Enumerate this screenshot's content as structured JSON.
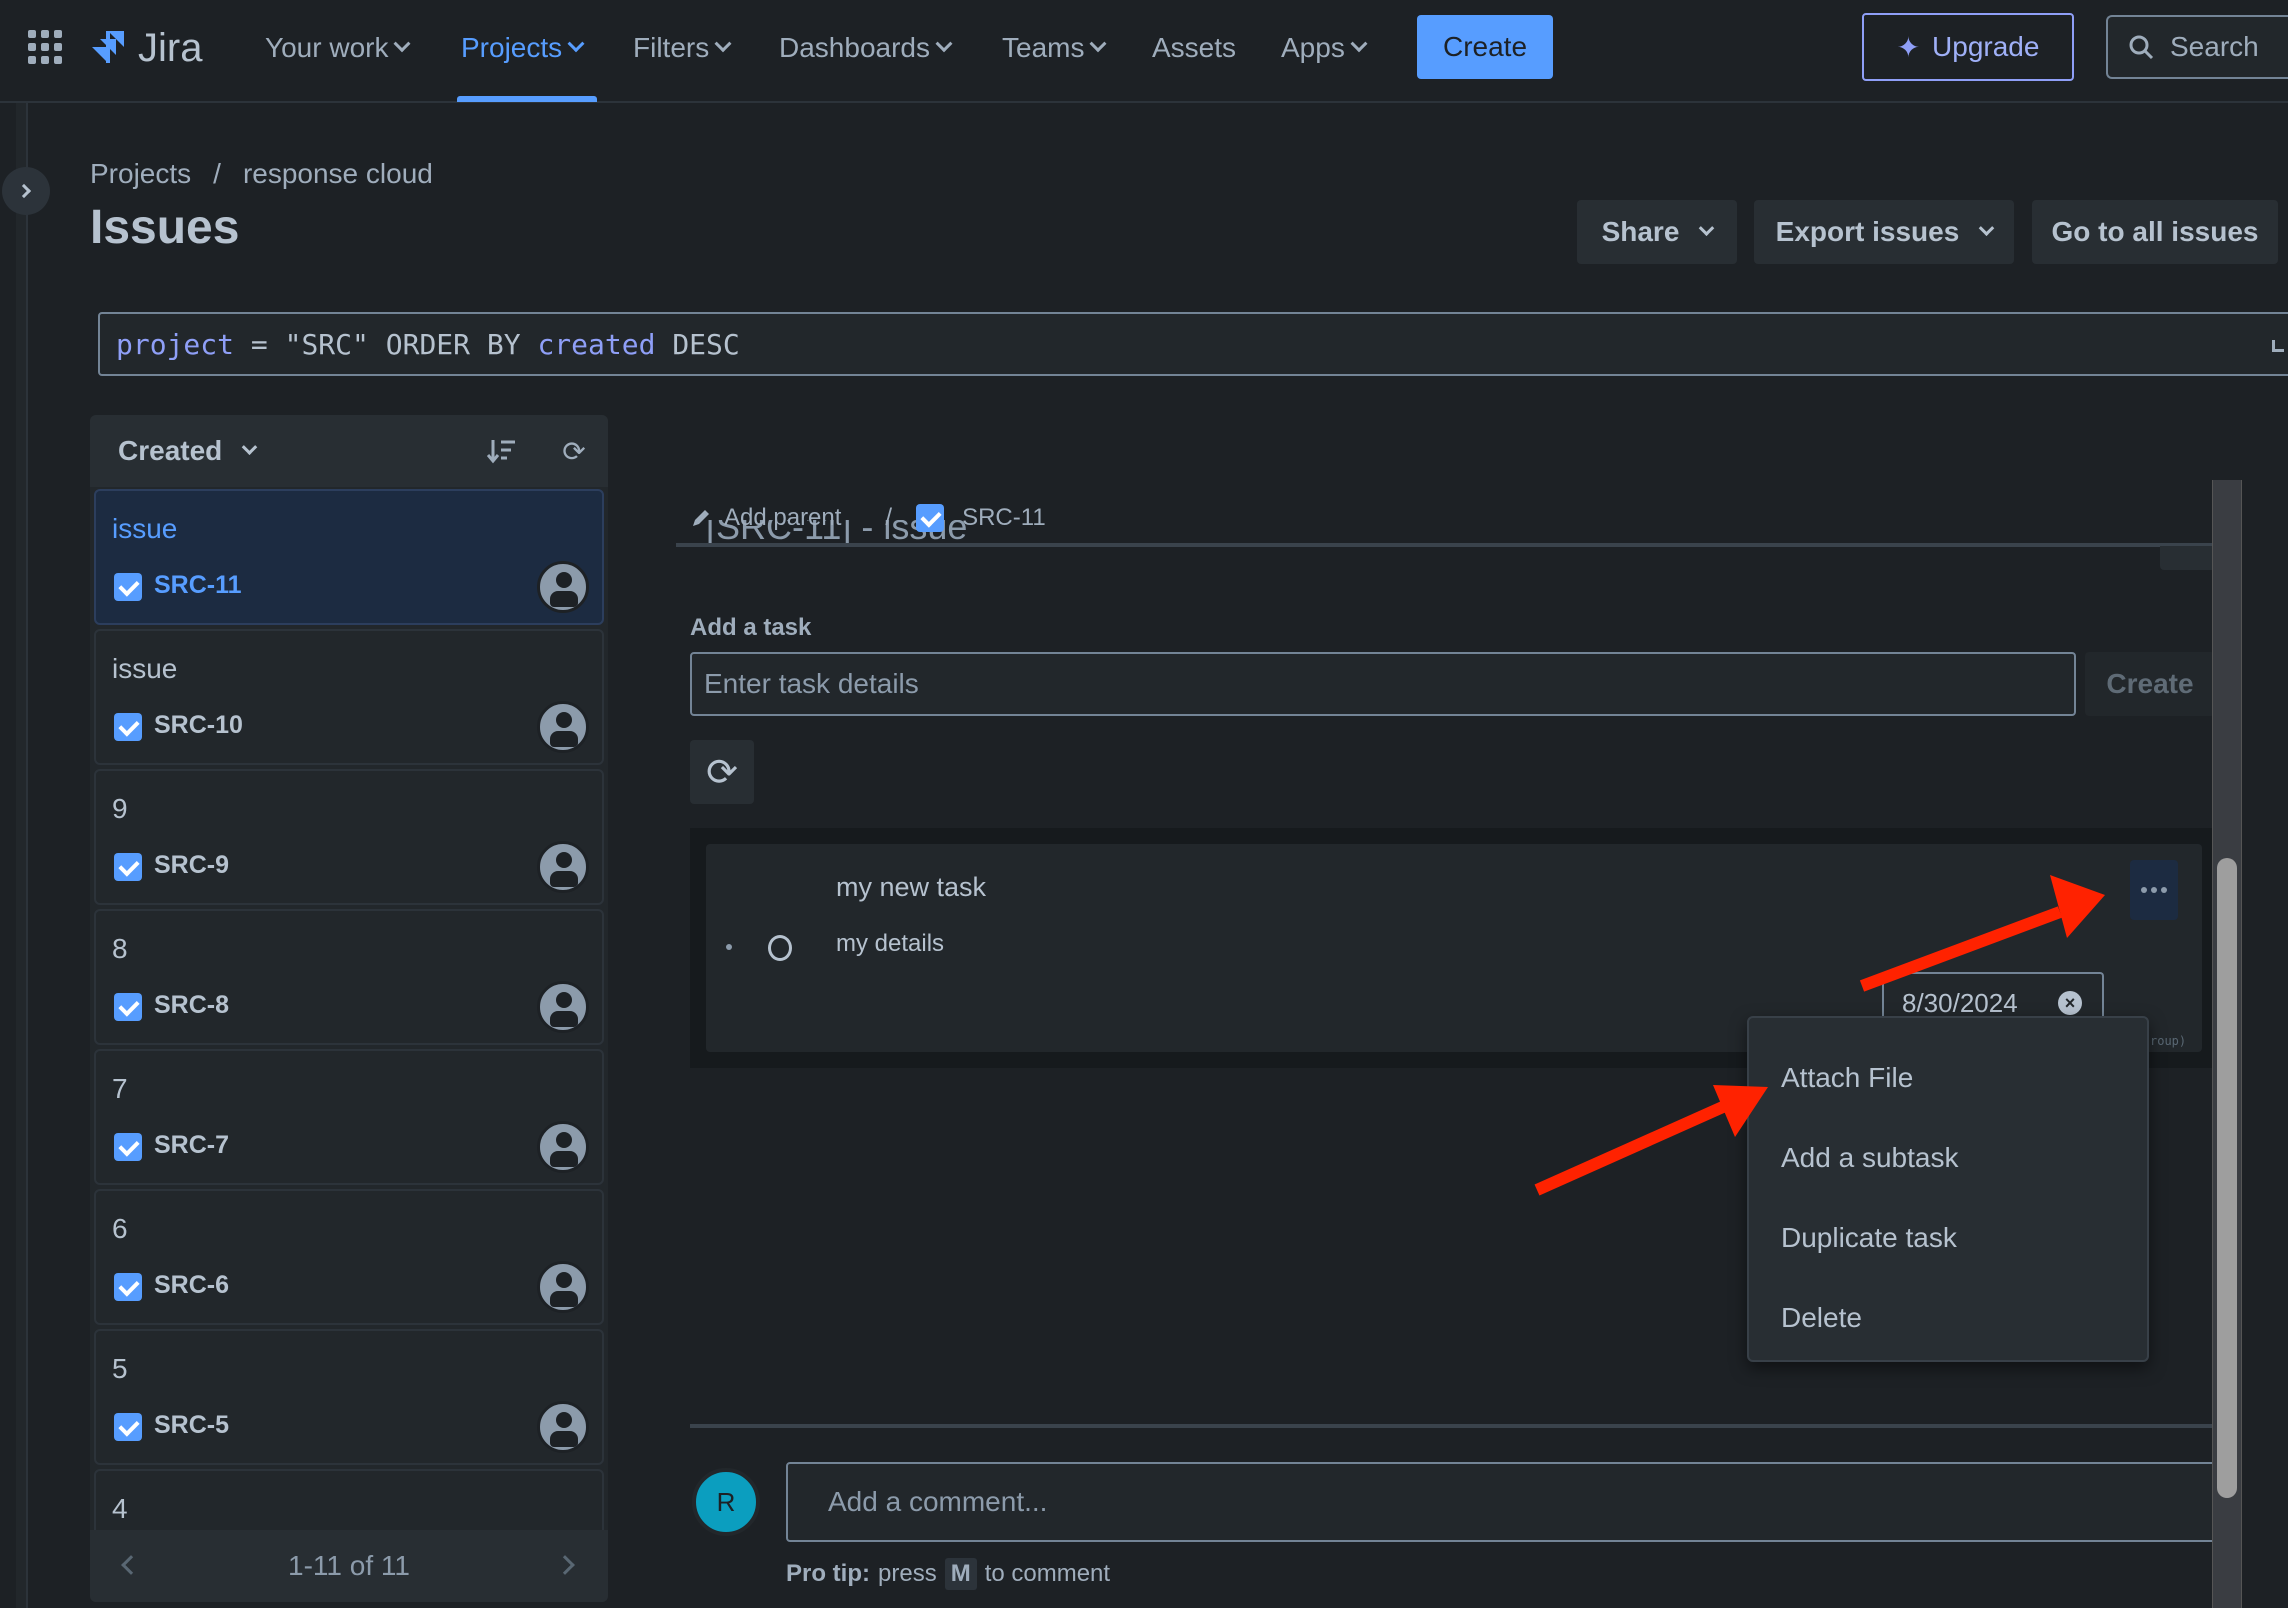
{
  "topnav": {
    "app_name": "Jira",
    "items": [
      {
        "label": "Your work",
        "dropdown": true
      },
      {
        "label": "Projects",
        "dropdown": true,
        "active": true
      },
      {
        "label": "Filters",
        "dropdown": true
      },
      {
        "label": "Dashboards",
        "dropdown": true
      },
      {
        "label": "Teams",
        "dropdown": true
      },
      {
        "label": "Assets",
        "dropdown": false
      },
      {
        "label": "Apps",
        "dropdown": true
      }
    ],
    "create_label": "Create",
    "upgrade_label": "Upgrade",
    "search_placeholder": "Search"
  },
  "breadcrumb": {
    "items": [
      "Projects",
      "response cloud"
    ],
    "separator": "/"
  },
  "page_title": "Issues",
  "header_actions": {
    "share": "Share",
    "export": "Export issues",
    "go_all": "Go to all issues"
  },
  "jql": {
    "tokens": [
      {
        "text": "project",
        "kw": true
      },
      {
        "text": " = \"SRC\" ORDER BY ",
        "kw": false
      },
      {
        "text": "created",
        "kw": true
      },
      {
        "text": " DESC",
        "kw": false
      }
    ]
  },
  "issue_list": {
    "sort_label": "Created",
    "items": [
      {
        "title": "issue",
        "key": "SRC-11",
        "selected": true
      },
      {
        "title": "issue",
        "key": "SRC-10",
        "selected": false
      },
      {
        "title": "9",
        "key": "SRC-9",
        "selected": false
      },
      {
        "title": "8",
        "key": "SRC-8",
        "selected": false
      },
      {
        "title": "7",
        "key": "SRC-7",
        "selected": false
      },
      {
        "title": "6",
        "key": "SRC-6",
        "selected": false
      },
      {
        "title": "5",
        "key": "SRC-5",
        "selected": false
      },
      {
        "title": "4",
        "key": "",
        "selected": false
      }
    ],
    "pagination": "1-11 of 11"
  },
  "detail": {
    "add_parent": "Add parent",
    "separator": "/",
    "issue_key": "SRC-11",
    "title_ghost": "[SRC-11] - issue",
    "add_task_label": "Add a task",
    "task_input_placeholder": "Enter task details",
    "task_create": "Create",
    "task": {
      "title": "my new task",
      "details": "my details",
      "date": "8/30/2024",
      "group_hint": "roup)"
    },
    "task_menu": [
      "Attach File",
      "Add a subtask",
      "Duplicate task",
      "Delete"
    ],
    "comment": {
      "avatar_initial": "R",
      "placeholder": "Add a comment...",
      "pro_tip_label": "Pro tip:",
      "pro_tip_pre": "press",
      "pro_tip_key": "M",
      "pro_tip_post": "to comment"
    }
  },
  "colors": {
    "accent": "#579dff",
    "background": "#1d2125",
    "annotation_arrow": "#ff2200",
    "avatar": "#0b9ebf"
  }
}
